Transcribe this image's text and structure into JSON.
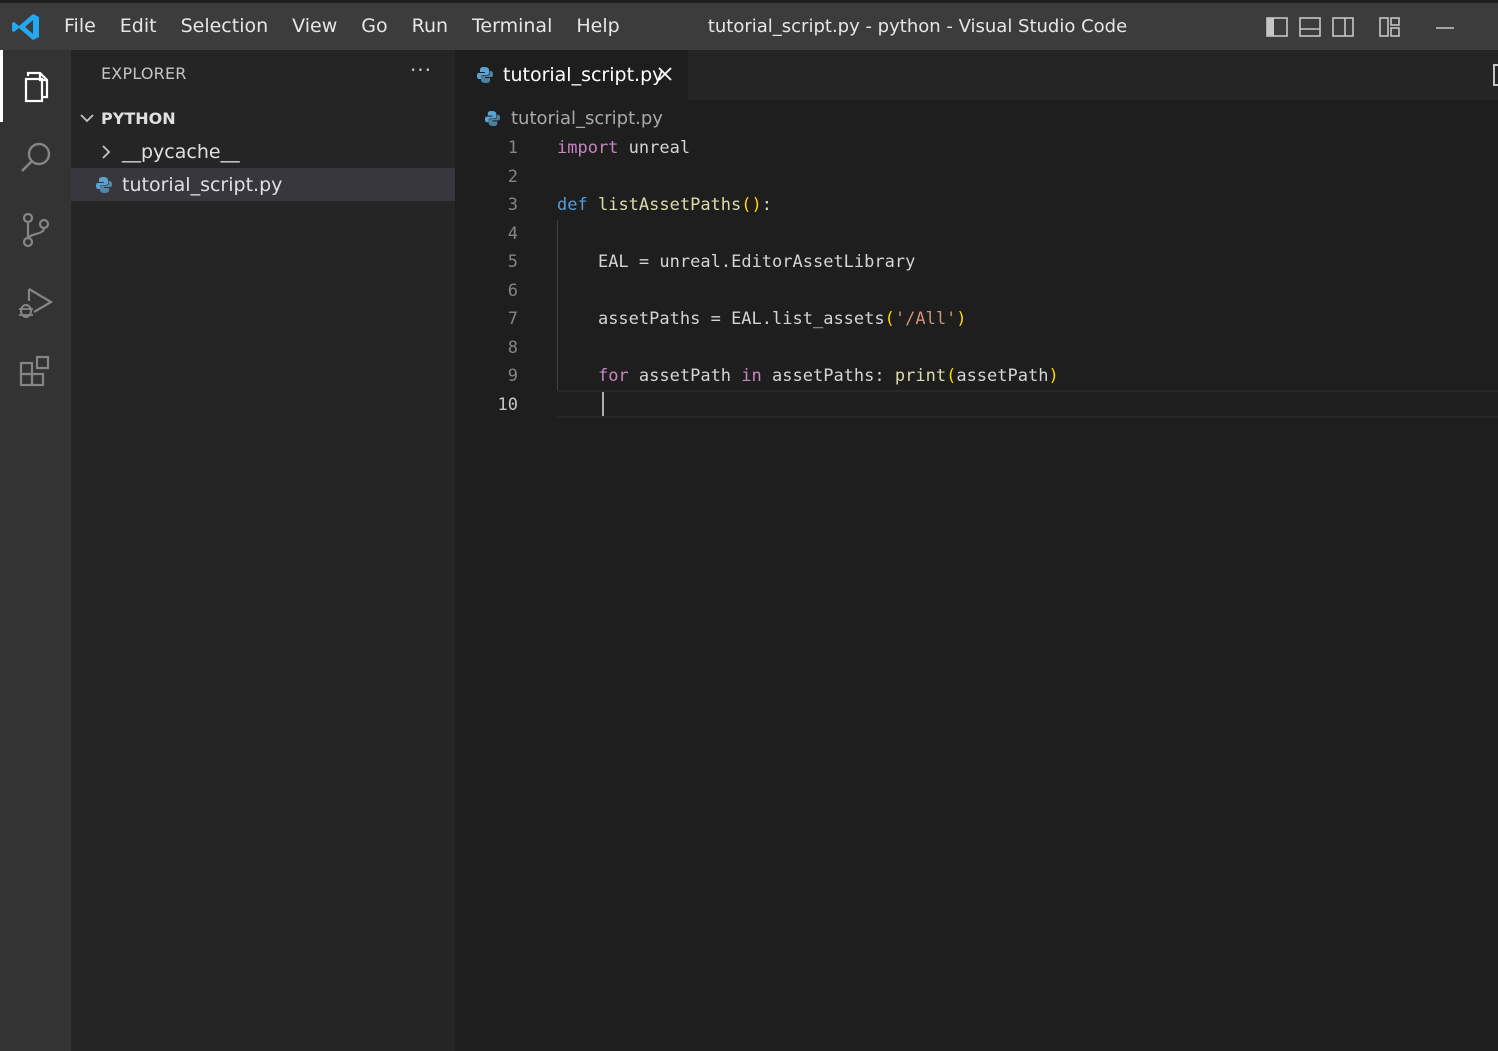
{
  "window": {
    "title": "tutorial_script.py - python - Visual Studio Code",
    "menu": [
      "File",
      "Edit",
      "Selection",
      "View",
      "Go",
      "Run",
      "Terminal",
      "Help"
    ]
  },
  "activity_bar": {
    "items": [
      "explorer-icon",
      "search-icon",
      "source-control-icon",
      "run-debug-icon",
      "extensions-icon"
    ],
    "active": "explorer-icon"
  },
  "sidebar": {
    "header": "EXPLORER",
    "more": "···",
    "folder": "PYTHON",
    "items": [
      {
        "label": "__pycache__",
        "type": "folder",
        "expanded": false
      },
      {
        "label": "tutorial_script.py",
        "type": "python-file",
        "selected": true
      }
    ]
  },
  "editor": {
    "tab": {
      "label": "tutorial_script.py",
      "active": true
    },
    "breadcrumb": "tutorial_script.py",
    "current_line": 10,
    "lines": [
      {
        "num": "1",
        "text": "import unreal"
      },
      {
        "num": "2",
        "text": ""
      },
      {
        "num": "3",
        "text": "def listAssetPaths():"
      },
      {
        "num": "4",
        "text": ""
      },
      {
        "num": "5",
        "text": "    EAL = unreal.EditorAssetLibrary"
      },
      {
        "num": "6",
        "text": ""
      },
      {
        "num": "7",
        "text": "    assetPaths = EAL.list_assets('/All')"
      },
      {
        "num": "8",
        "text": ""
      },
      {
        "num": "9",
        "text": "    for assetPath in assetPaths: print(assetPath)"
      },
      {
        "num": "10",
        "text": ""
      }
    ]
  },
  "colors": {
    "keyword": "#c586c0",
    "def": "#569cd6",
    "function": "#dcdcaa",
    "bracket": "#ffd700",
    "string": "#ce9178",
    "text": "#d4d4d4",
    "vscode_blue": "#23a9f2",
    "python_icon": "#5ba3d0"
  }
}
